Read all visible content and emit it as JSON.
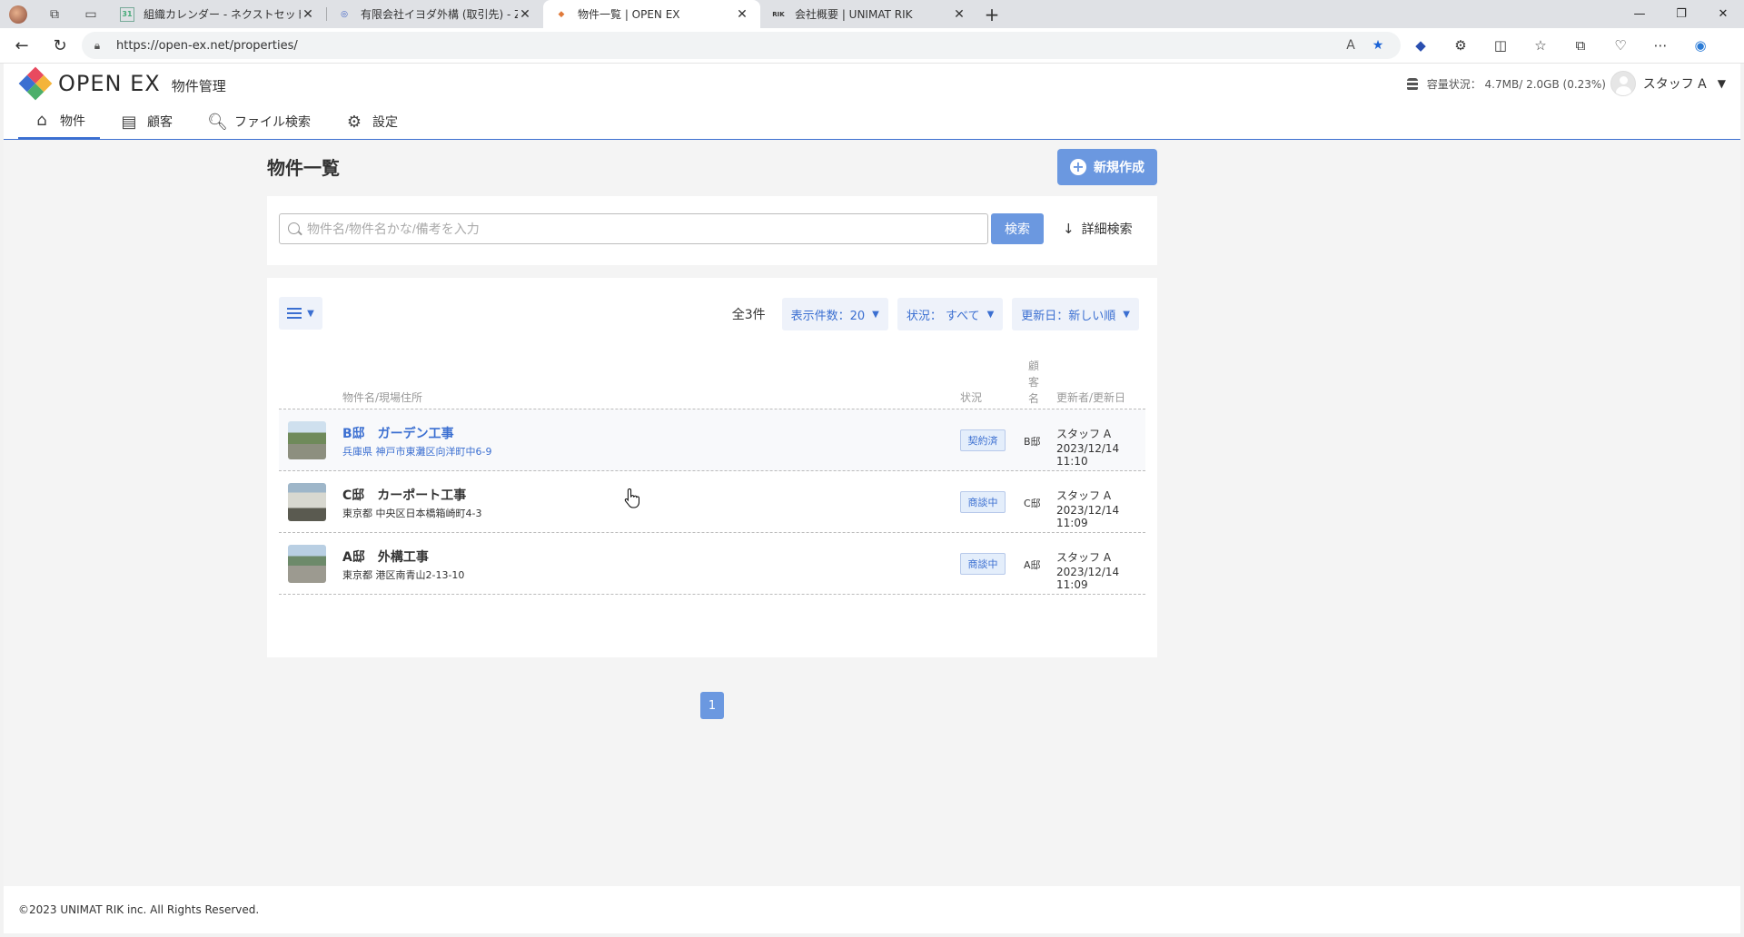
{
  "browser": {
    "tabs": [
      {
        "title": "組織カレンダー - ネクストセット",
        "favicon": "31",
        "active": false
      },
      {
        "title": "有限会社イヨダ外構 (取引先) - Zoh",
        "favicon": "◎",
        "active": false
      },
      {
        "title": "物件一覧 | OPEN EX",
        "favicon": "◆",
        "active": true
      },
      {
        "title": "会社概要 | UNIMAT RIK",
        "favicon": "RIK",
        "active": false
      }
    ],
    "url": "https://open-ex.net/properties/"
  },
  "app": {
    "logo_text": "OPEN EX",
    "logo_sub": "物件管理",
    "storage": "容量状況： 4.7MB/ 2.0GB (0.23%)",
    "user": "スタッフ A",
    "nav": [
      {
        "label": "物件",
        "icon": "home-icon",
        "active": true
      },
      {
        "label": "顧客",
        "icon": "id-card-icon",
        "active": false
      },
      {
        "label": "ファイル検索",
        "icon": "file-search-icon",
        "active": false
      },
      {
        "label": "設定",
        "icon": "gear-icon",
        "active": false
      }
    ],
    "colors": {
      "accent": "#3b6fd1",
      "button": "#6b98e0"
    }
  },
  "page": {
    "title": "物件一覧",
    "new_button": "新規作成",
    "search": {
      "placeholder": "物件名/物件名かな/備考を入力",
      "button": "検索",
      "advanced": "詳細検索"
    },
    "list": {
      "total": "全3件",
      "per_page": "表示件数：20",
      "status_filter": "状況： すべて",
      "sort": "更新日：新しい順",
      "headers": {
        "name": "物件名/現場住所",
        "status": "状況",
        "customer": "顧客名",
        "updated": "更新者/更新日"
      },
      "rows": [
        {
          "name": "B邸　ガーデン工事",
          "address": "兵庫県 神戸市東灘区向洋町中6-9",
          "status": "契約済",
          "customer": "B邸",
          "updated_by": "スタッフ A",
          "updated_at": "2023/12/14 11:10"
        },
        {
          "name": "C邸　カーポート工事",
          "address": "東京都 中央区日本橋箱崎町4-3",
          "status": "商談中",
          "customer": "C邸",
          "updated_by": "スタッフ A",
          "updated_at": "2023/12/14 11:09"
        },
        {
          "name": "A邸　外構工事",
          "address": "東京都 港区南青山2-13-10",
          "status": "商談中",
          "customer": "A邸",
          "updated_by": "スタッフ A",
          "updated_at": "2023/12/14 11:09"
        }
      ],
      "page": "1"
    },
    "footer": "©2023 UNIMAT RIK inc. All Rights Reserved."
  }
}
